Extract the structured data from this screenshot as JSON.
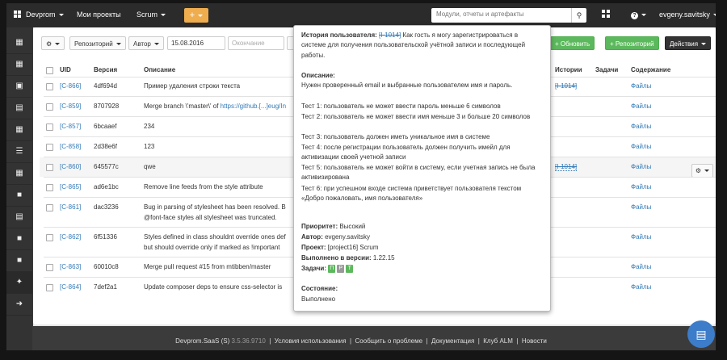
{
  "topbar": {
    "brand": "Devprom",
    "projects": "Мои проекты",
    "scrum": "Scrum",
    "plus": "+",
    "search_placeholder": "Модули, отчеты и артефакты",
    "help": "?",
    "user": "evgeny.savitsky"
  },
  "toolbar": {
    "settings": "⚙",
    "repository": "Репозиторий",
    "author": "Автор",
    "date_from": "15.08.2016",
    "date_to_placeholder": "Окончание",
    "refresh": "Обновить",
    "add_repository": "Репозиторий",
    "actions": "Действия"
  },
  "table": {
    "columns": [
      "UID",
      "Версия",
      "Описание",
      "Истории",
      "Задачи",
      "Содержание"
    ],
    "rows": [
      {
        "uid": "[C-866]",
        "version": "4df694d",
        "desc": "Пример удаления строки текста",
        "desc2": "",
        "story": "[I-1014]",
        "content": "Файлы"
      },
      {
        "uid": "[C-859]",
        "version": "8707928",
        "desc": "Merge branch \\'master\\' of ",
        "desc_link": "https://github.[...]eug/In",
        "desc2": "",
        "story": "",
        "content": "Файлы"
      },
      {
        "uid": "[C-857]",
        "version": "6bcaaef",
        "desc": "234",
        "desc2": "",
        "story": "",
        "content": "Файлы"
      },
      {
        "uid": "[C-858]",
        "version": "2d38e6f",
        "desc": "123",
        "desc2": "",
        "story": "",
        "content": "Файлы"
      },
      {
        "uid": "[C-860]",
        "version": "645577c",
        "desc": "qwe",
        "desc2": "",
        "story": "[I-1014]",
        "content": "Файлы"
      },
      {
        "uid": "[C-865]",
        "version": "ad6e1bc",
        "desc": "Remove line feeds from the style attribute",
        "desc2": "",
        "story": "",
        "content": "Файлы"
      },
      {
        "uid": "[C-861]",
        "version": "dac3236",
        "desc": "Bug in parsing of stylesheet has been resolved. B",
        "desc2": "@font-face styles all stylesheet was truncated.",
        "story": "",
        "content": "Файлы"
      },
      {
        "uid": "[C-862]",
        "version": "6f51336",
        "desc": "Styles defined in class shouldnt override ones def",
        "desc2": "but should override only if marked as !important",
        "story": "",
        "content": "Файлы"
      },
      {
        "uid": "[C-863]",
        "version": "60010c8",
        "desc": "Merge pull request #15 from mtibben/master",
        "desc2": "",
        "story": "",
        "content": "Файлы"
      },
      {
        "uid": "[C-864]",
        "version": "7def2a1",
        "desc": "Update composer deps to ensure css-selector is",
        "desc2": "",
        "story": "",
        "content": "Файлы"
      }
    ]
  },
  "popup": {
    "title_label": "История пользователя",
    "title_id": "[I-1014]",
    "title_text": " Как гость я могу зарегистрироваться в системе для получения пользовательской учётной записи и последующей работы.",
    "desc_label": "Описание",
    "desc_intro": "Нужен проверенный email и выбранные пользователем имя и пароль.",
    "tests": [
      "Тест 1: пользователь не может ввести пароль меньше 6 символов",
      "Тест 2: пользователь не может ввести имя меньше 3 и больше 20 символов",
      "Тест 3: пользователь должен иметь уникальное имя в системе",
      "Тест 4: после регистрации пользователь должен получить имейл для активизации своей учетной записи",
      "Тест 5: пользователь не может войти в систему, если учетная запись не была активизирована",
      "Тест 6: при успешном входе система приветствует пользователя текстом «Добро пожаловать, имя пользователя»"
    ],
    "priority_label": "Приоритет",
    "priority": "Высокий",
    "author_label": "Автор",
    "author": "evgeny.savitsky",
    "project_label": "Проект",
    "project": "[project16] Scrum",
    "done_label": "Выполнено в версии",
    "done": "1.22.15",
    "tasks_label": "Задачи",
    "tasks": [
      "П",
      "Р",
      "Т"
    ],
    "state_label": "Состояние",
    "state": "Выполнено"
  },
  "footer": {
    "brand": "Devprom.SaaS (S)",
    "version": "3.5.36.9710",
    "links": [
      "Условия использования",
      "Сообщить о проблеме",
      "Документация",
      "Клуб ALM",
      "Новости"
    ]
  },
  "colors": {
    "accent": "#f0ad4e",
    "green": "#5cb85c",
    "link": "#337ab7",
    "topbar": "#2b2b2b"
  }
}
